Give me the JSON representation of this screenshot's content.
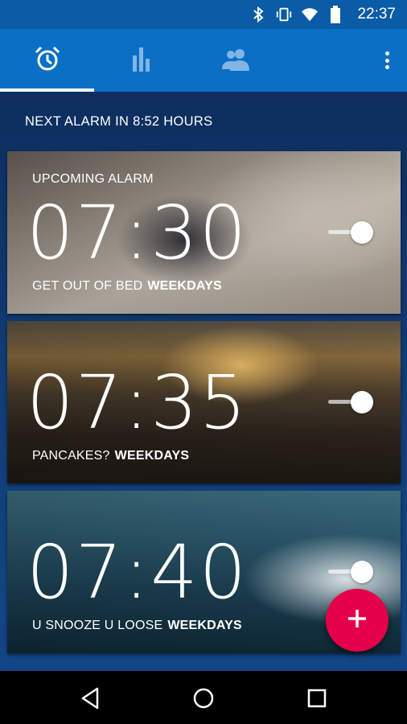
{
  "status_bar": {
    "time": "22:37",
    "icons": [
      "bluetooth-icon",
      "vibrate-icon",
      "wifi-icon",
      "battery-icon"
    ]
  },
  "toolbar": {
    "tabs": [
      {
        "name": "alarm",
        "icon": "alarm-clock-icon",
        "active": true
      },
      {
        "name": "stats",
        "icon": "bar-chart-icon",
        "active": false
      },
      {
        "name": "social",
        "icon": "people-icon",
        "active": false
      }
    ],
    "overflow_icon": "more-vert-icon"
  },
  "next_alarm": "NEXT ALARM IN 8:52 HOURS",
  "alarms": [
    {
      "label": "UPCOMING ALARM",
      "time": "07:30",
      "name": "GET OUT OF BED",
      "repeat": "WEEKDAYS",
      "enabled": true
    },
    {
      "label": "",
      "time": "07:35",
      "name": "PANCAKES?",
      "repeat": "WEEKDAYS",
      "enabled": true
    },
    {
      "label": "",
      "time": "07:40",
      "name": "U SNOOZE U LOOSE",
      "repeat": "WEEKDAYS",
      "enabled": true
    }
  ],
  "fab": {
    "icon": "plus-icon"
  },
  "nav": {
    "icons": [
      "back-icon",
      "home-icon",
      "recents-icon"
    ]
  },
  "colors": {
    "toolbar": "#0b6fc5",
    "accent": "#e5004a",
    "background": "#123f7a"
  }
}
